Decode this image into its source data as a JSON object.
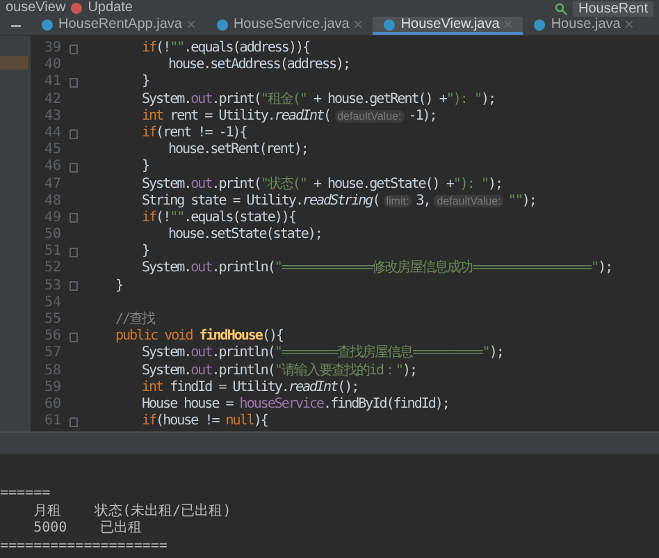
{
  "top_bar": {
    "breadcrumb": "ouseView",
    "run_config": "Update",
    "project_button": "HouseRent"
  },
  "tabs": [
    {
      "label": "HouseRentApp.java",
      "selected": false
    },
    {
      "label": "HouseService.java",
      "selected": false
    },
    {
      "label": "HouseView.java",
      "selected": true
    },
    {
      "label": "House.java",
      "selected": false
    }
  ],
  "code_lines": [
    {
      "children": [
        {
          "number": "39",
          "fold": true,
          "tokens": [
            {
              "kind": "keyword",
              "text": "if"
            },
            {
              "kind": "plain",
              "text": "(!"
            },
            {
              "kind": "string",
              "text": "\"\""
            },
            {
              "kind": "plain",
              "text": ".equals(address)){"
            }
          ],
          "children": [
            {
              "number": "40",
              "fold": false,
              "tokens": [
                {
                  "kind": "plain",
                  "text": "house.setAddress(address);"
                }
              ]
            }
          ]
        },
        {
          "number": "41",
          "fold": true,
          "tokens": [
            {
              "kind": "plain",
              "text": "}"
            }
          ]
        },
        {
          "number": "42",
          "fold": false,
          "tokens": [
            {
              "kind": "plain",
              "text": "System."
            },
            {
              "kind": "field",
              "text": "out"
            },
            {
              "kind": "plain",
              "text": ".print("
            },
            {
              "kind": "string",
              "text": "\"租金(\""
            },
            {
              "kind": "plain",
              "text": " + house.getRent() +"
            },
            {
              "kind": "string",
              "text": "\"): \""
            },
            {
              "kind": "plain",
              "text": ");"
            }
          ]
        },
        {
          "number": "43",
          "fold": false,
          "tokens": [
            {
              "kind": "keyword",
              "text": "int"
            },
            {
              "kind": "plain",
              "text": " rent = Utility."
            },
            {
              "kind": "static",
              "text": "readInt"
            },
            {
              "kind": "plain",
              "text": "("
            },
            {
              "kind": "hint",
              "text": "defaultValue:"
            },
            {
              "kind": "plain",
              "text": "-1);"
            }
          ]
        },
        {
          "number": "44",
          "fold": true,
          "tokens": [
            {
              "kind": "keyword",
              "text": "if"
            },
            {
              "kind": "plain",
              "text": "(rent != -1){"
            }
          ],
          "children": [
            {
              "number": "45",
              "fold": false,
              "tokens": [
                {
                  "kind": "plain",
                  "text": "house.setRent(rent);"
                }
              ]
            }
          ]
        },
        {
          "number": "46",
          "fold": true,
          "tokens": [
            {
              "kind": "plain",
              "text": "}"
            }
          ]
        },
        {
          "number": "47",
          "fold": false,
          "tokens": [
            {
              "kind": "plain",
              "text": "System."
            },
            {
              "kind": "field",
              "text": "out"
            },
            {
              "kind": "plain",
              "text": ".print("
            },
            {
              "kind": "string",
              "text": "\"状态(\""
            },
            {
              "kind": "plain",
              "text": " + house.getState() +"
            },
            {
              "kind": "string",
              "text": "\"): \""
            },
            {
              "kind": "plain",
              "text": ");"
            }
          ]
        },
        {
          "number": "48",
          "fold": false,
          "tokens": [
            {
              "kind": "plain",
              "text": "String state = Utility."
            },
            {
              "kind": "static",
              "text": "readString"
            },
            {
              "kind": "plain",
              "text": "("
            },
            {
              "kind": "hint",
              "text": "limit:"
            },
            {
              "kind": "plain",
              "text": "3,"
            },
            {
              "kind": "hint",
              "text": "defaultValue:"
            },
            {
              "kind": "string",
              "text": "\"\""
            },
            {
              "kind": "plain",
              "text": ");"
            }
          ]
        },
        {
          "number": "49",
          "fold": true,
          "tokens": [
            {
              "kind": "keyword",
              "text": "if"
            },
            {
              "kind": "plain",
              "text": "(!"
            },
            {
              "kind": "string",
              "text": "\"\""
            },
            {
              "kind": "plain",
              "text": ".equals(state)){"
            }
          ],
          "children": [
            {
              "number": "50",
              "fold": false,
              "tokens": [
                {
                  "kind": "plain",
                  "text": "house.setState(state);"
                }
              ]
            }
          ]
        },
        {
          "number": "51",
          "fold": true,
          "tokens": [
            {
              "kind": "plain",
              "text": "}"
            }
          ]
        },
        {
          "number": "52",
          "fold": false,
          "tokens": [
            {
              "kind": "plain",
              "text": "System."
            },
            {
              "kind": "field",
              "text": "out"
            },
            {
              "kind": "plain",
              "text": ".println("
            },
            {
              "kind": "string",
              "text": "\"=============修改房屋信息成功=================\""
            },
            {
              "kind": "plain",
              "text": ");"
            }
          ]
        }
      ]
    },
    {
      "number": "53",
      "fold": true,
      "tokens": [
        {
          "kind": "plain",
          "text": "}"
        }
      ]
    },
    {
      "number": "54",
      "fold": false
    },
    {
      "number": "55",
      "fold": false,
      "tokens": [
        {
          "kind": "comment",
          "text": "//查找"
        }
      ]
    },
    {
      "number": "56",
      "fold": true,
      "tokens": [
        {
          "kind": "keyword",
          "text": "public void "
        },
        {
          "kind": "method",
          "text": "findHouse"
        },
        {
          "kind": "plain",
          "text": "(){"
        }
      ],
      "children": [
        {
          "number": "57",
          "fold": false,
          "tokens": [
            {
              "kind": "plain",
              "text": "System."
            },
            {
              "kind": "field",
              "text": "out"
            },
            {
              "kind": "plain",
              "text": ".println("
            },
            {
              "kind": "string",
              "text": "\"========查找房屋信息==========\""
            },
            {
              "kind": "plain",
              "text": ");"
            }
          ]
        },
        {
          "number": "58",
          "fold": false,
          "tokens": [
            {
              "kind": "plain",
              "text": "System."
            },
            {
              "kind": "field",
              "text": "out"
            },
            {
              "kind": "plain",
              "text": ".println("
            },
            {
              "kind": "string",
              "text": "\"请输入要查找的id：\""
            },
            {
              "kind": "plain",
              "text": ");"
            }
          ]
        },
        {
          "number": "59",
          "fold": false,
          "tokens": [
            {
              "kind": "keyword",
              "text": "int"
            },
            {
              "kind": "plain",
              "text": " findId = Utility."
            },
            {
              "kind": "static",
              "text": "readInt"
            },
            {
              "kind": "plain",
              "text": "();"
            }
          ]
        },
        {
          "number": "60",
          "fold": false,
          "tokens": [
            {
              "kind": "plain",
              "text": "House house = "
            },
            {
              "kind": "field",
              "text": "houseService"
            },
            {
              "kind": "plain",
              "text": ".findById(findId);"
            }
          ]
        },
        {
          "number": "61",
          "fold": true,
          "tokens": [
            {
              "kind": "keyword",
              "text": "if"
            },
            {
              "kind": "plain",
              "text": "(house != "
            },
            {
              "kind": "keyword",
              "text": "null"
            },
            {
              "kind": "plain",
              "text": "){"
            }
          ]
        }
      ]
    }
  ],
  "console": [
    "======",
    "    月租    状态(未出租/已出租)",
    "    5000    已出租",
    "===================="
  ]
}
